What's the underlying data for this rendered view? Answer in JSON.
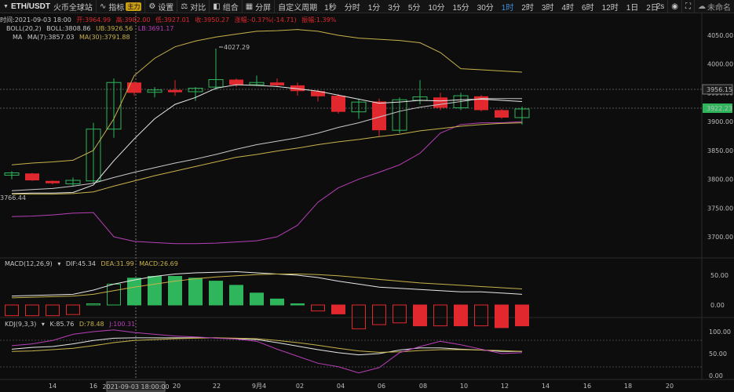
{
  "toolbar": {
    "symbol": "ETH/USDT",
    "exchange": "火币全球站",
    "indicator_label": "指标",
    "indicator_badge": "主力",
    "settings_label": "设置",
    "compare_label": "对比",
    "combine_label": "组合",
    "share_label": "分屏",
    "custom_period_label": "自定义周期",
    "timeframes": [
      "1秒",
      "分时",
      "1分",
      "3分",
      "5分",
      "10分",
      "15分",
      "30分",
      "1时",
      "2时",
      "3时",
      "4时",
      "6时",
      "12时",
      "1日",
      "2日"
    ],
    "active_timeframe": "1时",
    "refresh_label": "2s",
    "user_label": "未命名"
  },
  "ohlc": {
    "time": "时间:2021-09-03 18:00",
    "open": "开:3964.99",
    "high": "高:3982.00",
    "low": "低:3927.01",
    "close": "收:3950.27",
    "change": "涨幅:-0.37%(-14.71)",
    "amplitude": "振幅:1.39%"
  },
  "boll": {
    "name": "BOLL(20,2)",
    "boll": "BOLL:3808.86",
    "ub": "UB:3926.56",
    "lb": "LB:3691.17"
  },
  "ma": {
    "name": "MA",
    "ma7": "MA(7):3857.03",
    "ma30": "MA(30):3791.88"
  },
  "macd": {
    "name": "MACD(12,26,9)",
    "dif": "DIF:45.34",
    "dea": "DEA:31.99",
    "macd": "MACD:26.69"
  },
  "kdj": {
    "name": "KDJ(9,3,3)",
    "k": "K:85.76",
    "d": "D:78.48",
    "j": "J:100.31"
  },
  "main_axis": {
    "ticks": [
      "4050.00",
      "4000.00",
      "3950.00",
      "3900.00",
      "3850.00",
      "3800.00",
      "3750.00",
      "3700.00"
    ],
    "current_price": "3922.23",
    "cursor_price": "3956.15"
  },
  "annotations": {
    "high": "4027.29",
    "low": "3766.44"
  },
  "macd_axis": {
    "ticks": [
      "50.00",
      "0.00"
    ]
  },
  "kdj_axis": {
    "ticks": [
      "100.00",
      "50.00",
      "0.00"
    ]
  },
  "x_axis": {
    "labels": [
      "14",
      "16",
      "20",
      "22",
      "9月4",
      "02",
      "04",
      "06",
      "08",
      "10",
      "12",
      "14",
      "16",
      "18",
      "20"
    ],
    "cursor_time": "2021-09-03 18:00:00"
  },
  "colors": {
    "up": "#2fb65c",
    "down": "#e0282e",
    "boll": "#c8c8c8",
    "ub": "#c8b24a",
    "lb": "#b73fb7",
    "ma30": "#c8b24a",
    "accent": "#3a8fe0"
  },
  "chart_data": {
    "type": "candlestick",
    "candles": [
      {
        "o": 3807,
        "h": 3814,
        "l": 3800,
        "c": 3811
      },
      {
        "o": 3810,
        "h": 3811,
        "l": 3797,
        "c": 3798
      },
      {
        "o": 3797,
        "h": 3798,
        "l": 3791,
        "c": 3793
      },
      {
        "o": 3792,
        "h": 3803,
        "l": 3787,
        "c": 3798
      },
      {
        "o": 3797,
        "h": 3898,
        "l": 3794,
        "c": 3887
      },
      {
        "o": 3887,
        "h": 3975,
        "l": 3872,
        "c": 3968
      },
      {
        "o": 3968,
        "h": 3970,
        "l": 3945,
        "c": 3950
      },
      {
        "o": 3951,
        "h": 3960,
        "l": 3942,
        "c": 3955
      },
      {
        "o": 3955,
        "h": 3972,
        "l": 3945,
        "c": 3951
      },
      {
        "o": 3952,
        "h": 3960,
        "l": 3936,
        "c": 3958
      },
      {
        "o": 3960,
        "h": 4027,
        "l": 3955,
        "c": 3973
      },
      {
        "o": 3973,
        "h": 3975,
        "l": 3960,
        "c": 3964
      },
      {
        "o": 3964,
        "h": 3980,
        "l": 3962,
        "c": 3968
      },
      {
        "o": 3968,
        "h": 3975,
        "l": 3960,
        "c": 3963
      },
      {
        "o": 3963,
        "h": 3968,
        "l": 3945,
        "c": 3953
      },
      {
        "o": 3953,
        "h": 3955,
        "l": 3935,
        "c": 3944
      },
      {
        "o": 3945,
        "h": 3948,
        "l": 3914,
        "c": 3917
      },
      {
        "o": 3917,
        "h": 3940,
        "l": 3905,
        "c": 3934
      },
      {
        "o": 3935,
        "h": 3940,
        "l": 3875,
        "c": 3885
      },
      {
        "o": 3885,
        "h": 3942,
        "l": 3880,
        "c": 3938
      },
      {
        "o": 3937,
        "h": 3972,
        "l": 3930,
        "c": 3943
      },
      {
        "o": 3942,
        "h": 3950,
        "l": 3920,
        "c": 3924
      },
      {
        "o": 3924,
        "h": 3950,
        "l": 3920,
        "c": 3945
      },
      {
        "o": 3944,
        "h": 3946,
        "l": 3918,
        "c": 3920
      },
      {
        "o": 3920,
        "h": 3922,
        "l": 3905,
        "c": 3907
      },
      {
        "o": 3907,
        "h": 3926,
        "l": 3895,
        "c": 3922
      }
    ],
    "boll_mid": [
      3780,
      3782,
      3784,
      3788,
      3793,
      3803,
      3812,
      3820,
      3828,
      3835,
      3843,
      3852,
      3860,
      3866,
      3872,
      3880,
      3890,
      3898,
      3908,
      3918,
      3925,
      3930,
      3935,
      3940,
      3940,
      3940
    ],
    "boll_up": [
      3825,
      3828,
      3830,
      3833,
      3850,
      3905,
      3980,
      4010,
      4030,
      4040,
      4047,
      4052,
      4057,
      4058,
      4060,
      4057,
      4050,
      4045,
      4043,
      4041,
      4037,
      4020,
      3992,
      3990,
      3988,
      3986
    ],
    "boll_low": [
      3735,
      3736,
      3738,
      3741,
      3742,
      3700,
      3692,
      3690,
      3688,
      3688,
      3689,
      3691,
      3693,
      3700,
      3720,
      3760,
      3785,
      3800,
      3812,
      3825,
      3845,
      3880,
      3895,
      3898,
      3898,
      3900
    ],
    "ma7": [
      3775,
      3776,
      3776,
      3777,
      3790,
      3832,
      3870,
      3905,
      3930,
      3942,
      3958,
      3964,
      3963,
      3961,
      3957,
      3953,
      3946,
      3939,
      3932,
      3934,
      3937,
      3936,
      3938,
      3939,
      3937,
      3935
    ],
    "ma30": [
      3774,
      3774,
      3774,
      3775,
      3778,
      3788,
      3797,
      3806,
      3814,
      3822,
      3830,
      3838,
      3843,
      3849,
      3854,
      3860,
      3865,
      3869,
      3874,
      3878,
      3884,
      3888,
      3892,
      3895,
      3897,
      3898
    ],
    "macd_hist": [
      -18,
      -18,
      -18,
      -16,
      2,
      35,
      45,
      48,
      48,
      45,
      40,
      33,
      20,
      10,
      2,
      -10,
      -15,
      -40,
      -33,
      -30,
      -35,
      -35,
      -35,
      -35,
      -38,
      -35
    ],
    "macd_dif": [
      15,
      16,
      17,
      18,
      25,
      35,
      42,
      48,
      52,
      54,
      55,
      56,
      54,
      52,
      50,
      46,
      40,
      35,
      30,
      28,
      26,
      24,
      22,
      22,
      20,
      18
    ],
    "macd_dea": [
      12,
      13,
      14,
      15,
      18,
      24,
      30,
      35,
      40,
      44,
      47,
      49,
      51,
      52,
      52,
      51,
      49,
      46,
      43,
      40,
      37,
      35,
      33,
      31,
      29,
      27
    ],
    "kdj_k": [
      60,
      64,
      66,
      72,
      80,
      85,
      86,
      86,
      86,
      86,
      86,
      84,
      82,
      75,
      67,
      59,
      52,
      47,
      50,
      58,
      63,
      63,
      60,
      58,
      55,
      55
    ],
    "kdj_d": [
      55,
      56,
      59,
      62,
      68,
      75,
      80,
      82,
      84,
      85,
      86,
      85,
      84,
      80,
      75,
      69,
      62,
      56,
      53,
      54,
      57,
      59,
      59,
      58,
      57,
      55
    ],
    "kdj_j": [
      68,
      72,
      80,
      94,
      100,
      104,
      98,
      94,
      90,
      88,
      85,
      83,
      78,
      60,
      44,
      28,
      20,
      6,
      18,
      52,
      66,
      78,
      70,
      60,
      50,
      52
    ]
  }
}
